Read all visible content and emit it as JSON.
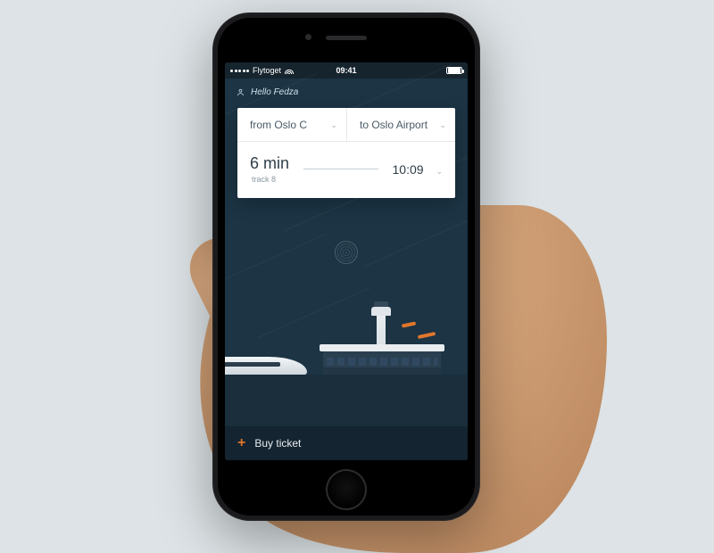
{
  "statusbar": {
    "carrier": "Flytoget",
    "time": "09:41"
  },
  "greeting": "Hello Fedza",
  "journey": {
    "from_label": "from Oslo C",
    "to_label": "to Oslo Airport",
    "departure_in": "6 min",
    "track_label": "track 8",
    "arrival_time": "10:09"
  },
  "buy": {
    "label": "Buy ticket"
  },
  "colors": {
    "accent": "#e0762c",
    "bg": "#1c3444"
  }
}
